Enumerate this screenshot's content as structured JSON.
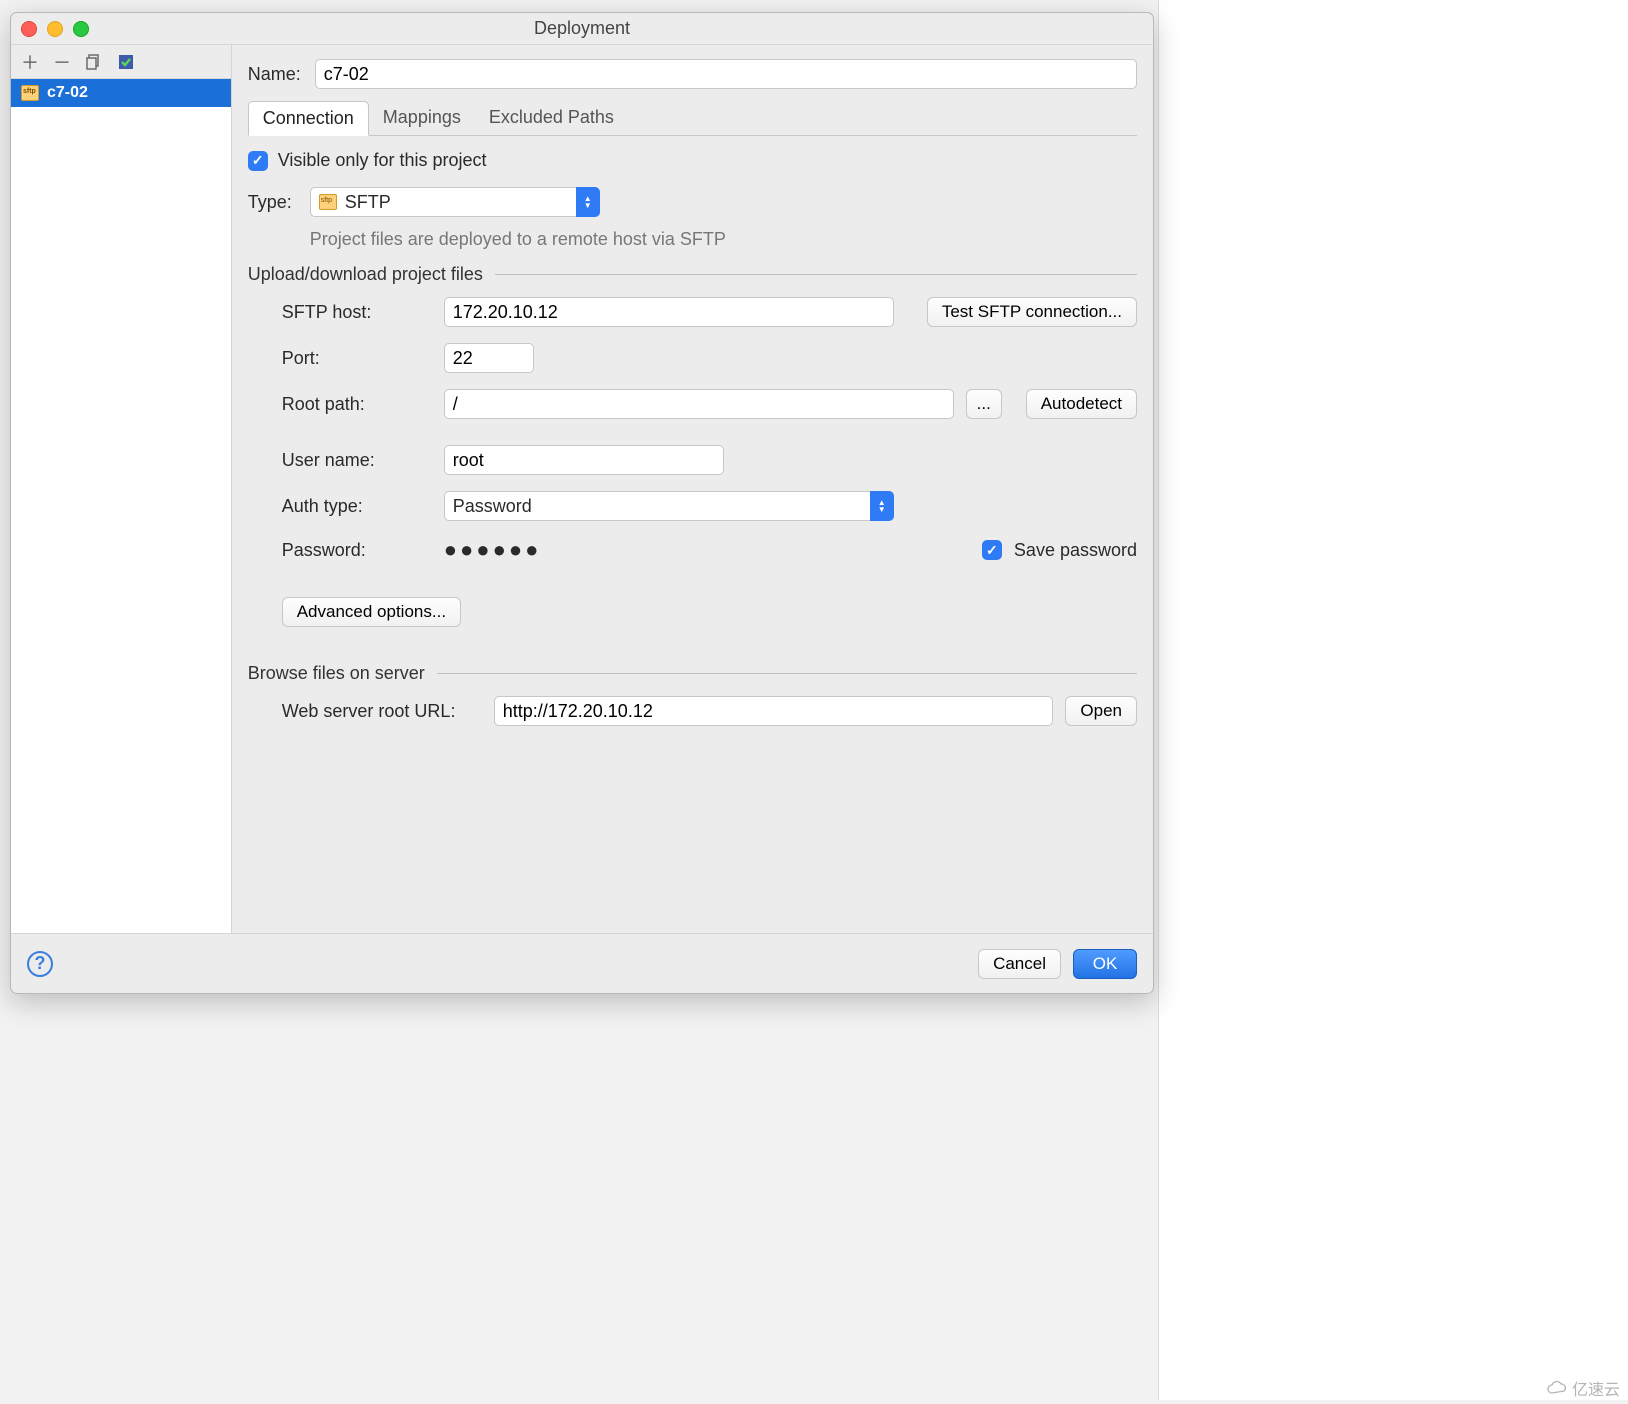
{
  "window": {
    "title": "Deployment"
  },
  "sidebar": {
    "selected_item": "c7-02"
  },
  "content": {
    "name_label": "Name:",
    "name_value": "c7-02",
    "tabs": [
      "Connection",
      "Mappings",
      "Excluded Paths"
    ],
    "visible_only_label": "Visible only for this project",
    "type_label": "Type:",
    "type_value": "SFTP",
    "type_hint": "Project files are deployed to a remote host via SFTP",
    "section_upload": "Upload/download project files",
    "sftp_host_label": "SFTP host:",
    "sftp_host_value": "172.20.10.12",
    "test_btn": "Test SFTP connection...",
    "port_label": "Port:",
    "port_value": "22",
    "root_label": "Root path:",
    "root_value": "/",
    "browse_btn": "...",
    "autodetect_btn": "Autodetect",
    "user_label": "User name:",
    "user_value": "root",
    "auth_label": "Auth type:",
    "auth_value": "Password",
    "password_label": "Password:",
    "password_value": "●●●●●●",
    "save_pw_label": "Save password",
    "advanced_btn": "Advanced options...",
    "section_browse": "Browse files on server",
    "web_root_label": "Web server root URL:",
    "web_root_value": "http://172.20.10.12",
    "open_btn": "Open"
  },
  "footer": {
    "cancel": "Cancel",
    "ok": "OK"
  },
  "watermark": "亿速云"
}
